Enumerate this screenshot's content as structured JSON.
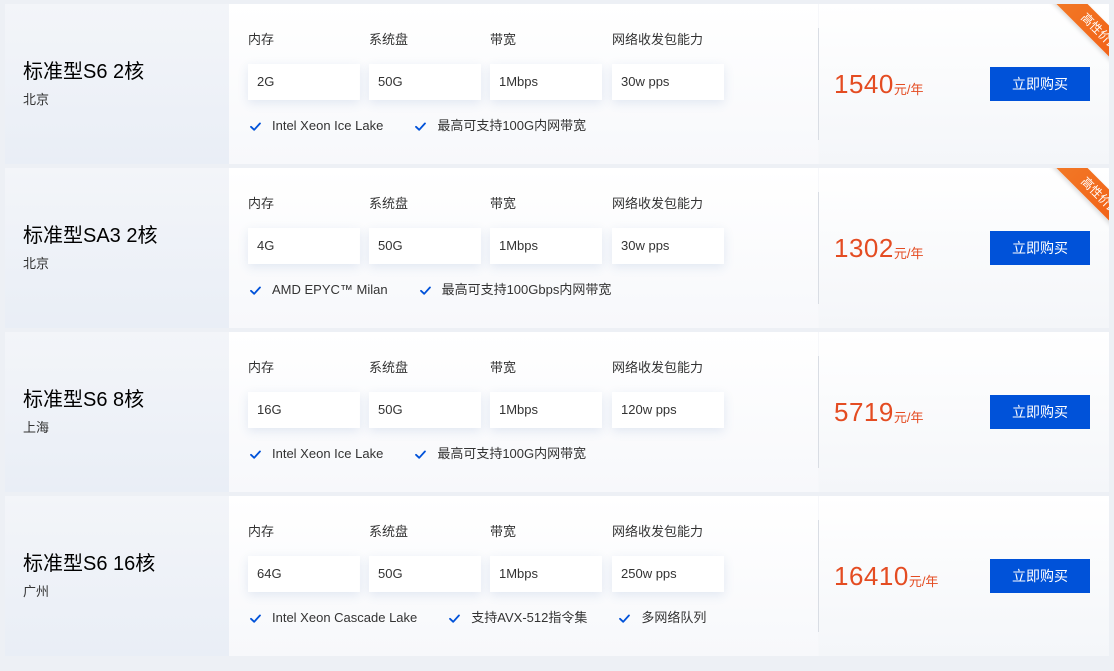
{
  "products": [
    {
      "name": "标准型S6 2核",
      "region": "北京",
      "specs": [
        {
          "label": "内存",
          "value": "2G"
        },
        {
          "label": "系统盘",
          "value": "50G"
        },
        {
          "label": "带宽",
          "value": "1Mbps"
        },
        {
          "label": "网络收发包能力",
          "value": "30w pps"
        }
      ],
      "features": [
        "Intel Xeon Ice Lake",
        "最高可支持100G内网带宽"
      ],
      "price": "1540",
      "price_unit": "元/年",
      "buy_label": "立即购买",
      "badge": "高性价比"
    },
    {
      "name": "标准型SA3 2核",
      "region": "北京",
      "specs": [
        {
          "label": "内存",
          "value": "4G"
        },
        {
          "label": "系统盘",
          "value": "50G"
        },
        {
          "label": "带宽",
          "value": "1Mbps"
        },
        {
          "label": "网络收发包能力",
          "value": "30w pps"
        }
      ],
      "features": [
        "AMD EPYC™ Milan",
        "最高可支持100Gbps内网带宽"
      ],
      "price": "1302",
      "price_unit": "元/年",
      "buy_label": "立即购买",
      "badge": "高性价比"
    },
    {
      "name": "标准型S6 8核",
      "region": "上海",
      "specs": [
        {
          "label": "内存",
          "value": "16G"
        },
        {
          "label": "系统盘",
          "value": "50G"
        },
        {
          "label": "带宽",
          "value": "1Mbps"
        },
        {
          "label": "网络收发包能力",
          "value": "120w pps"
        }
      ],
      "features": [
        "Intel Xeon Ice Lake",
        "最高可支持100G内网带宽"
      ],
      "price": "5719",
      "price_unit": "元/年",
      "buy_label": "立即购买",
      "badge": ""
    },
    {
      "name": "标准型S6 16核",
      "region": "广州",
      "specs": [
        {
          "label": "内存",
          "value": "64G"
        },
        {
          "label": "系统盘",
          "value": "50G"
        },
        {
          "label": "带宽",
          "value": "1Mbps"
        },
        {
          "label": "网络收发包能力",
          "value": "250w pps"
        }
      ],
      "features": [
        "Intel Xeon Cascade Lake",
        "支持AVX-512指令集",
        "多网络队列"
      ],
      "price": "16410",
      "price_unit": "元/年",
      "buy_label": "立即购买",
      "badge": ""
    }
  ],
  "colors": {
    "price": "#e44c22",
    "button": "#0052d9",
    "check": "#0052d9",
    "badge": "#f26a1b"
  },
  "icons": {
    "check": "check-icon"
  }
}
